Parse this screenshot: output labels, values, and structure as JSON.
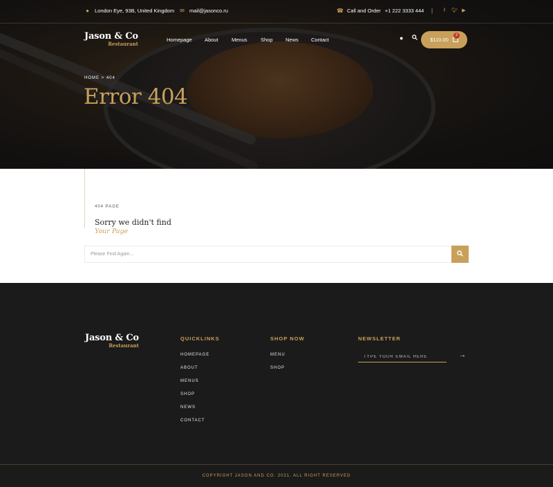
{
  "colors": {
    "accent": "#c9a05a",
    "footer_bg": "#1b1b1b",
    "badge": "#c0392b"
  },
  "topbar": {
    "address": "London Eye, 93B, United Kingdom",
    "email": "mail@jasonco.ru",
    "call_label": "Call and Order",
    "phone": "+1 222 3333 444",
    "separator": "|",
    "social": [
      "facebook-icon",
      "twitter-icon",
      "youtube-icon"
    ]
  },
  "brand": {
    "name": "Jason & Co",
    "tagline": "Restaurant"
  },
  "nav": {
    "items": [
      "Homepage",
      "About",
      "Menus",
      "Shop",
      "News",
      "Contact"
    ]
  },
  "cart": {
    "amount": "$110.00",
    "count": "2"
  },
  "hero": {
    "breadcrumb": "HOME > 404",
    "title": "Error 404"
  },
  "error": {
    "label": "404 PAGE",
    "heading": "Sorry we didn't find",
    "subheading": "Your Page",
    "search_placeholder": "Please Find Again..."
  },
  "footer": {
    "quicklinks_title": "QUICKLINKS",
    "quicklinks": [
      "HOMEPAGE",
      "ABOUT",
      "MENUS",
      "SHOP",
      "NEWS",
      "CONTACT"
    ],
    "shop_title": "SHOP NOW",
    "shop_links": [
      "MENU",
      "SHOP"
    ],
    "newsletter_title": "NEWSLETTER",
    "newsletter_placeholder": "TYPE YOUR EMAIL HERE",
    "copyright": "COPYRIGHT JASON AND CO. 2021. ALL RIGHT RESERVED"
  }
}
